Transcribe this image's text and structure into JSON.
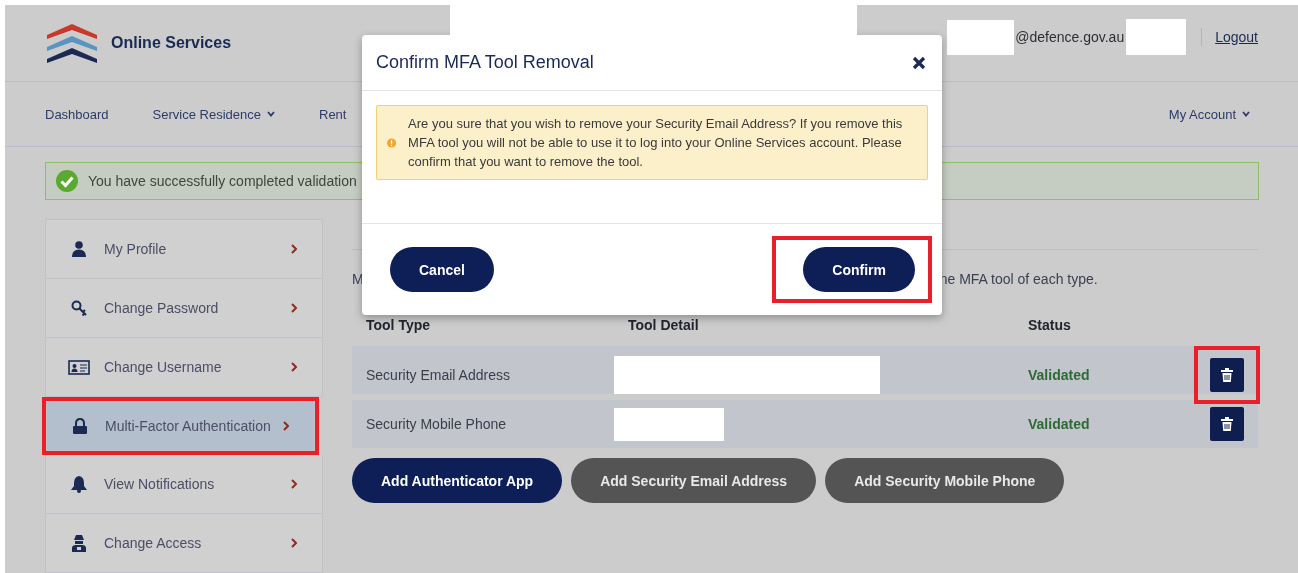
{
  "header": {
    "brand": "Online Services",
    "user_email": "@defence.gov.au",
    "logout": "Logout"
  },
  "nav": [
    {
      "label": "Dashboard",
      "dropdown": false
    },
    {
      "label": "Service Residence",
      "dropdown": true
    },
    {
      "label": "Rent",
      "dropdown": false
    }
  ],
  "nav_right": {
    "label": "My Account",
    "dropdown": true
  },
  "alert": {
    "text": "You have successfully completed validation"
  },
  "sidebar": [
    {
      "label": "My Profile",
      "kind": "person",
      "selected": false,
      "highlighted": false
    },
    {
      "label": "Change Password",
      "kind": "key",
      "selected": false,
      "highlighted": false
    },
    {
      "label": "Change Username",
      "kind": "card",
      "selected": false,
      "highlighted": false
    },
    {
      "label": "Multi-Factor Authentication",
      "kind": "lock",
      "selected": true,
      "highlighted": true
    },
    {
      "label": "View Notifications",
      "kind": "bell",
      "selected": false,
      "highlighted": false
    },
    {
      "label": "Change Access",
      "kind": "agent",
      "selected": false,
      "highlighted": false
    }
  ],
  "content": {
    "intro_start": "M",
    "intro_end": "ne MFA tool of each type."
  },
  "table": {
    "columns": [
      "Tool Type",
      "Tool Detail",
      "Status"
    ],
    "rows": [
      {
        "tool_type": "Security Email Address",
        "status": "Validated",
        "delete_highlighted": true
      },
      {
        "tool_type": "Security Mobile Phone",
        "status": "Validated",
        "delete_highlighted": false
      }
    ]
  },
  "actions": [
    {
      "label": "Add Authenticator App",
      "kind": "primary"
    },
    {
      "label": "Add Security Email Address",
      "kind": "secondary"
    },
    {
      "label": "Add Security Mobile Phone",
      "kind": "secondary"
    }
  ],
  "modal": {
    "title": "Confirm MFA Tool Removal",
    "warning": "Are you sure that you wish to remove your Security Email Address? If you remove this MFA tool you will not be able to use it to log into your Online Services account. Please confirm that you want to remove the tool.",
    "buttons": [
      {
        "label": "Cancel",
        "highlighted": false
      },
      {
        "label": "Confirm",
        "highlighted": true
      }
    ]
  }
}
